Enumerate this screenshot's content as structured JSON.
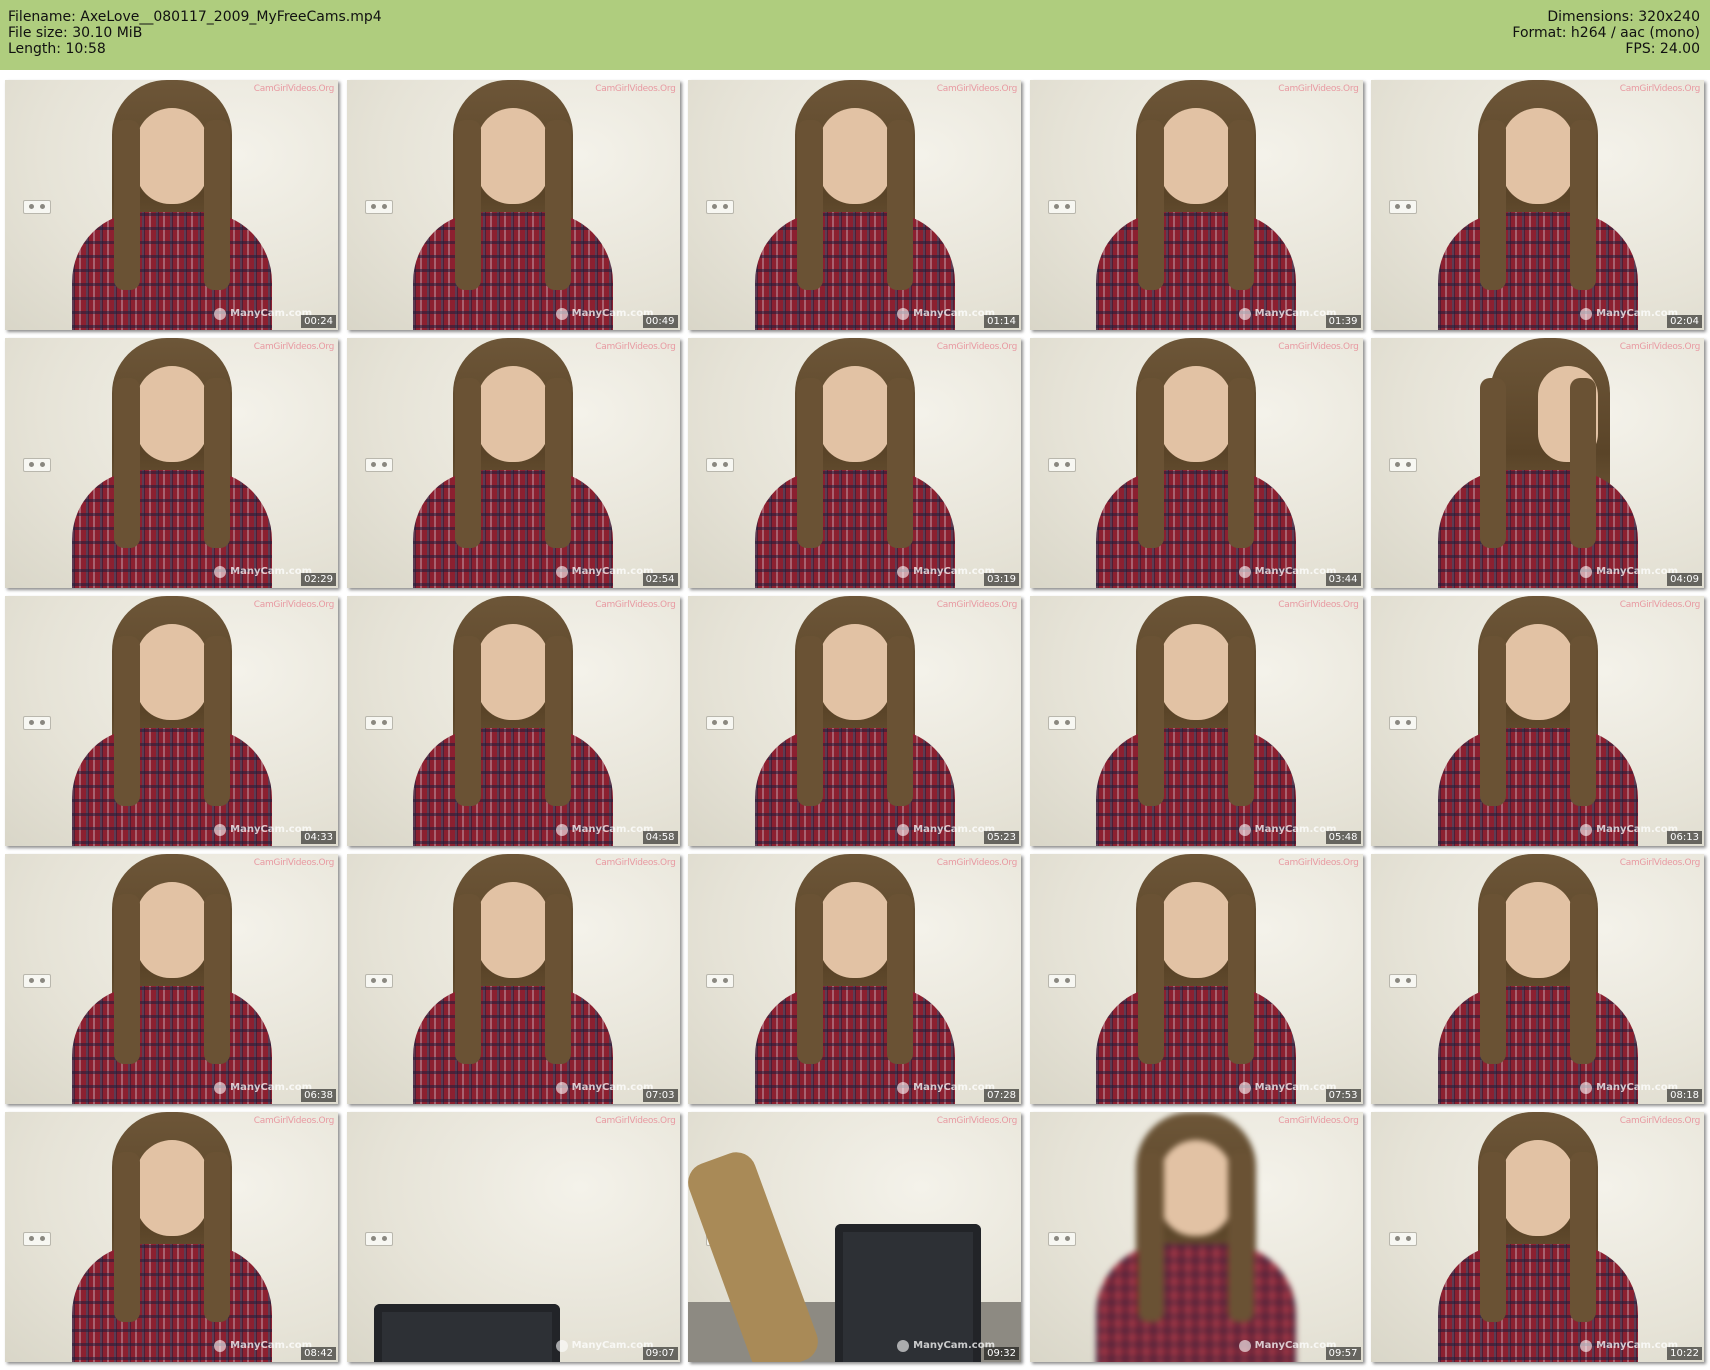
{
  "meta": {
    "filename": "Filename: AxeLove__080117_2009_MyFreeCams.mp4",
    "filesize": "File size: 30.10 MiB",
    "length": "Length: 10:58",
    "dimensions": "Dimensions: 320x240",
    "format": "Format: h264 / aac (mono)",
    "fps": "FPS: 24.00"
  },
  "colors": {
    "header_bg": "#afcd7e",
    "timestamp_bg": "rgba(0,0,0,0.55)",
    "watermark": "#e89aa2"
  },
  "watermark_text": "CamGirlVideos.Org",
  "overlay_text": "ManyCam.com",
  "thumbnails": [
    {
      "time": "00:24",
      "scene": "face"
    },
    {
      "time": "00:49",
      "scene": "face"
    },
    {
      "time": "01:14",
      "scene": "face"
    },
    {
      "time": "01:39",
      "scene": "face"
    },
    {
      "time": "02:04",
      "scene": "face"
    },
    {
      "time": "02:29",
      "scene": "face"
    },
    {
      "time": "02:54",
      "scene": "face"
    },
    {
      "time": "03:19",
      "scene": "face"
    },
    {
      "time": "03:44",
      "scene": "face"
    },
    {
      "time": "04:09",
      "scene": "turned"
    },
    {
      "time": "04:33",
      "scene": "face"
    },
    {
      "time": "04:58",
      "scene": "face"
    },
    {
      "time": "05:23",
      "scene": "face"
    },
    {
      "time": "05:48",
      "scene": "face"
    },
    {
      "time": "06:13",
      "scene": "face"
    },
    {
      "time": "06:38",
      "scene": "face"
    },
    {
      "time": "07:03",
      "scene": "face"
    },
    {
      "time": "07:28",
      "scene": "face"
    },
    {
      "time": "07:53",
      "scene": "face"
    },
    {
      "time": "08:18",
      "scene": "face"
    },
    {
      "time": "08:42",
      "scene": "face"
    },
    {
      "time": "09:07",
      "scene": "empty"
    },
    {
      "time": "09:32",
      "scene": "chair"
    },
    {
      "time": "09:57",
      "scene": "blur"
    },
    {
      "time": "10:22",
      "scene": "face"
    }
  ]
}
